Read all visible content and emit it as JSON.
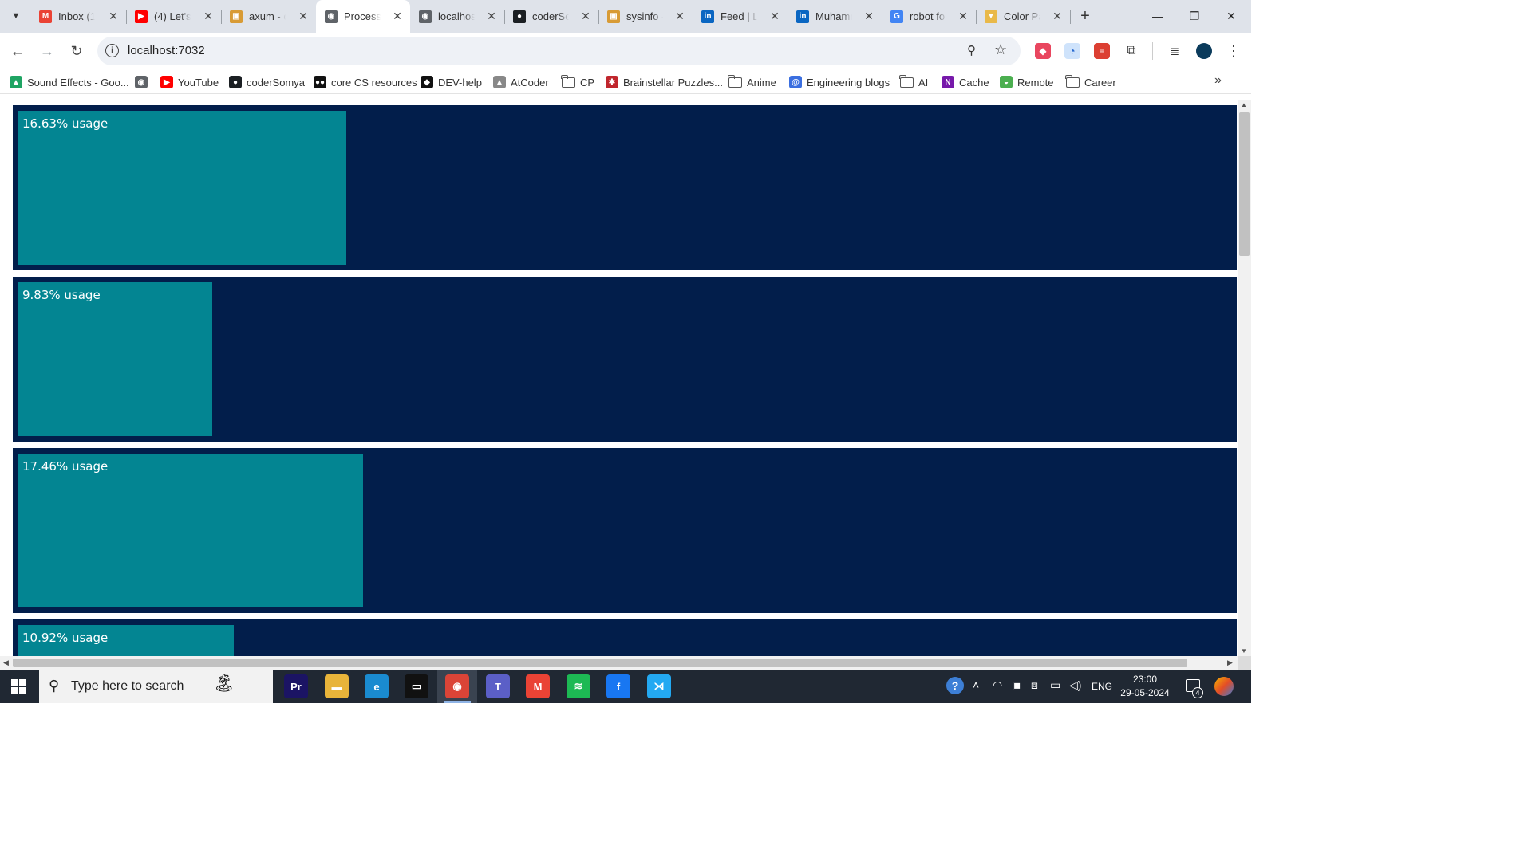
{
  "tabs": [
    {
      "title": "Inbox (1",
      "icon": "gmail-icon",
      "color": "#ea4335",
      "glyph": "M"
    },
    {
      "title": "(4) Let's",
      "icon": "youtube-icon",
      "color": "#ff0000",
      "glyph": "▶"
    },
    {
      "title": "axum - c",
      "icon": "docs-rs-icon",
      "color": "#d89b35",
      "glyph": "▣"
    },
    {
      "title": "Process",
      "icon": "globe-icon",
      "color": "#5f6368",
      "glyph": "◉",
      "active": true
    },
    {
      "title": "localhos",
      "icon": "globe-icon",
      "color": "#5f6368",
      "glyph": "◉"
    },
    {
      "title": "coderSo",
      "icon": "github-icon",
      "color": "#1b1f23",
      "glyph": "●"
    },
    {
      "title": "sysinfo -",
      "icon": "docs-rs-icon",
      "color": "#d89b35",
      "glyph": "▣"
    },
    {
      "title": "Feed | Li",
      "icon": "linkedin-icon",
      "color": "#0a66c2",
      "glyph": "in"
    },
    {
      "title": "Muhamr",
      "icon": "linkedin-icon",
      "color": "#0a66c2",
      "glyph": "in"
    },
    {
      "title": "robot fo",
      "icon": "google-icon",
      "color": "#4285f4",
      "glyph": "G"
    },
    {
      "title": "Color Pa",
      "icon": "color-palette-icon",
      "color": "#e9b949",
      "glyph": "▼"
    }
  ],
  "address": {
    "url": "localhost:7032"
  },
  "bookmarks": [
    {
      "label": "Sound Effects - Goo...",
      "icon": "google-drive-icon",
      "color": "#1fa463",
      "glyph": "▲"
    },
    {
      "label": "",
      "icon": "globe-icon",
      "color": "#5f6368",
      "glyph": "◉"
    },
    {
      "label": "YouTube",
      "icon": "youtube-icon",
      "color": "#ff0000",
      "glyph": "▶"
    },
    {
      "label": "coderSomya",
      "icon": "github-icon",
      "color": "#1b1f23",
      "glyph": "●"
    },
    {
      "label": "core CS resources",
      "icon": "medium-icon",
      "color": "#111111",
      "glyph": "●●"
    },
    {
      "label": "DEV-help",
      "icon": "dev-icon",
      "color": "#111111",
      "glyph": "◆"
    },
    {
      "label": "AtCoder",
      "icon": "atcoder-icon",
      "color": "#888888",
      "glyph": "▲"
    },
    {
      "label": "CP",
      "icon": "folder-icon",
      "folder": true
    },
    {
      "label": "Brainstellar Puzzles...",
      "icon": "brainstellar-icon",
      "color": "#c0262d",
      "glyph": "✱"
    },
    {
      "label": "Anime",
      "icon": "folder-icon",
      "folder": true
    },
    {
      "label": "Engineering blogs",
      "icon": "blog-icon",
      "color": "#3b6fe0",
      "glyph": "@"
    },
    {
      "label": "AI",
      "icon": "folder-icon",
      "folder": true
    },
    {
      "label": "Cache",
      "icon": "onenote-icon",
      "color": "#7719aa",
      "glyph": "N"
    },
    {
      "label": "Remote",
      "icon": "remote-icon",
      "color": "#4caf50",
      "glyph": "◒"
    },
    {
      "label": "Career",
      "icon": "folder-icon",
      "folder": true
    }
  ],
  "cpu_panels": [
    {
      "label": "16.63% usage",
      "usage": 16.63
    },
    {
      "label": "9.83% usage",
      "usage": 9.83
    },
    {
      "label": "17.46% usage",
      "usage": 17.46
    },
    {
      "label": "10.92% usage",
      "usage": 10.92
    }
  ],
  "colors": {
    "panel_bg": "#021e4b",
    "bar_fill": "#038592"
  },
  "taskbar": {
    "search_placeholder": "Type here to search",
    "time": "23:00",
    "date": "29-05-2024",
    "language": "ENG",
    "notification_count": "4",
    "apps": [
      {
        "name": "premiere-pro-icon",
        "glyph": "Pr",
        "color": "#1b1464"
      },
      {
        "name": "file-explorer-icon",
        "glyph": "▬",
        "color": "#e8b43a"
      },
      {
        "name": "edge-icon",
        "glyph": "e",
        "color": "#1a8bd0"
      },
      {
        "name": "terminal-icon",
        "glyph": "▭",
        "color": "#111111"
      },
      {
        "name": "chrome-icon",
        "glyph": "◉",
        "color": "#db4437",
        "active": true
      },
      {
        "name": "teams-icon",
        "glyph": "T",
        "color": "#5b5fc7"
      },
      {
        "name": "gmail-icon",
        "glyph": "M",
        "color": "#ea4335"
      },
      {
        "name": "spotify-icon",
        "glyph": "≋",
        "color": "#1db954"
      },
      {
        "name": "facebook-icon",
        "glyph": "f",
        "color": "#1877f2"
      },
      {
        "name": "vscode-icon",
        "glyph": "⋊",
        "color": "#23a9f2"
      }
    ]
  }
}
